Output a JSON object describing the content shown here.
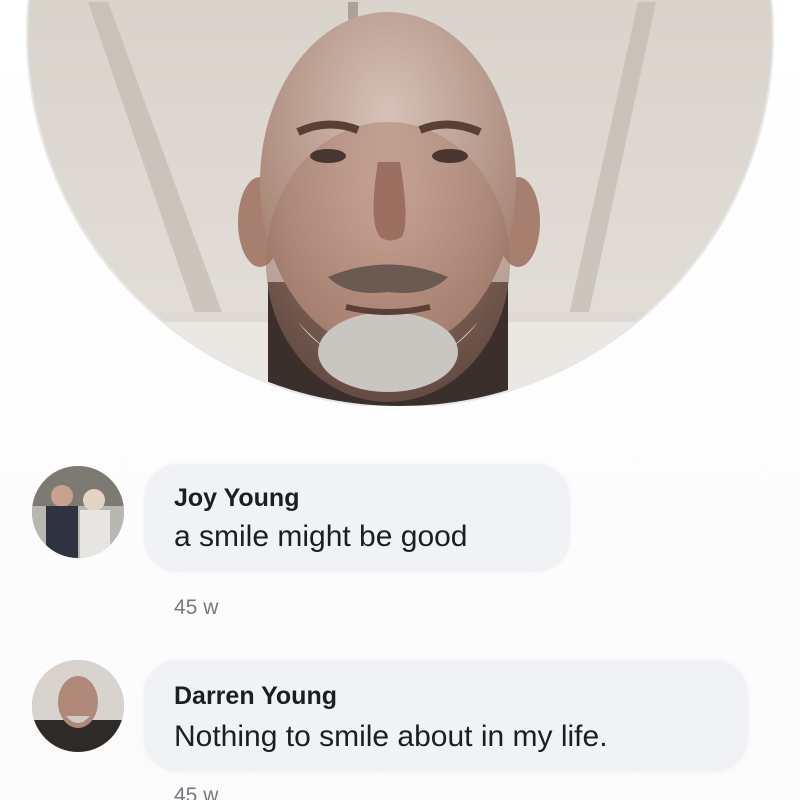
{
  "profile": {
    "photo_icon": "profile-photo"
  },
  "comments": [
    {
      "author": "Joy Young",
      "text": "a smile might be good",
      "time": "45 w",
      "avatar_icon": "couple-avatar"
    },
    {
      "author": "Darren Young",
      "text": "Nothing to smile about in my life.",
      "time": "45 w",
      "avatar_icon": "man-avatar"
    }
  ],
  "colors": {
    "bubble": "#f0f2f5",
    "text": "#1c1e21",
    "meta": "#767a80"
  }
}
